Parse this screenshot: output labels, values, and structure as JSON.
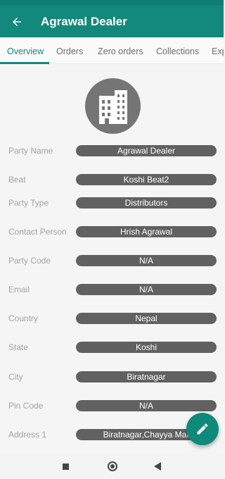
{
  "app": {
    "title": "Agrawal Dealer"
  },
  "tabs": [
    {
      "label": "Overview",
      "active": true
    },
    {
      "label": "Orders",
      "active": false
    },
    {
      "label": "Zero orders",
      "active": false
    },
    {
      "label": "Collections",
      "active": false
    },
    {
      "label": "Exp",
      "active": false
    }
  ],
  "fields": [
    {
      "label": "Party Name",
      "value": "Agrawal Dealer"
    },
    {
      "label": "Beat",
      "value": "Koshi Beat2"
    },
    {
      "label": "Party Type",
      "value": "Distributors"
    },
    {
      "label": "Contact Person",
      "value": "Hrish Agrawal"
    },
    {
      "label": "Party Code",
      "value": "N/A"
    },
    {
      "label": "Email",
      "value": "N/A"
    },
    {
      "label": "Country",
      "value": "Nepal"
    },
    {
      "label": "State",
      "value": "Koshi"
    },
    {
      "label": "City",
      "value": "Biratnagar"
    },
    {
      "label": "Pin Code",
      "value": "N/A"
    },
    {
      "label": "Address 1",
      "value": "Biratnagar,Chayya Mar"
    }
  ],
  "icons": {
    "back": "arrow-left-icon",
    "avatar": "building-icon",
    "fab": "pencil-icon",
    "nav_recents": "square-icon",
    "nav_home": "circle-icon",
    "nav_back": "triangle-back-icon"
  },
  "colors": {
    "primary": "#12897a",
    "pill": "#616161",
    "label": "#a3a3a3"
  }
}
